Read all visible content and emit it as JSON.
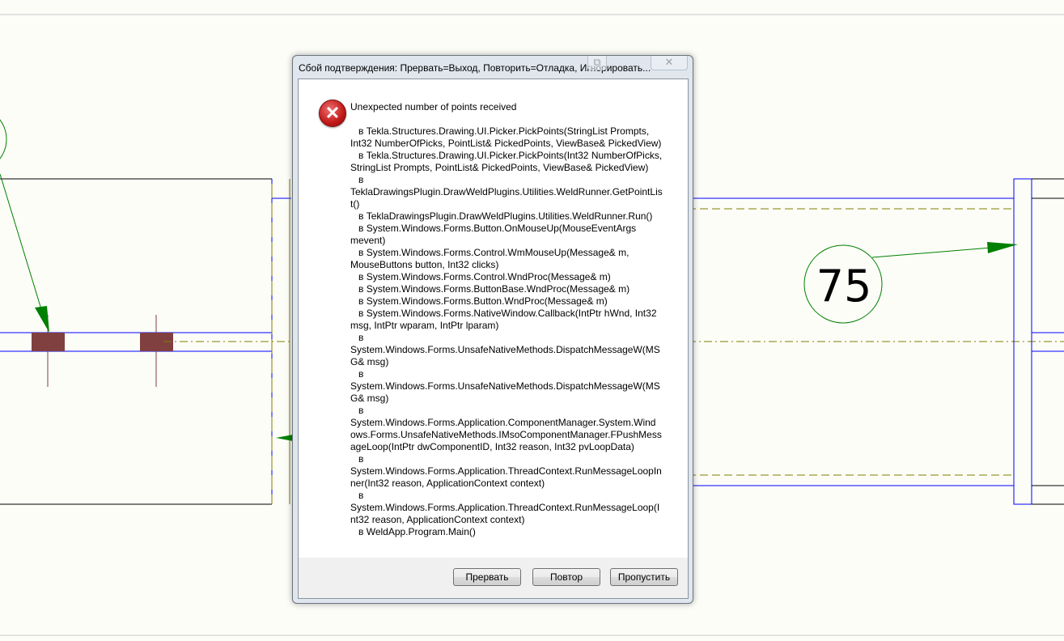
{
  "drawing": {
    "weld_mark_label": "75",
    "colors": {
      "part_outline": "#0000ff",
      "center_line": "#808000",
      "mark": "#008000",
      "weld": "#804040",
      "outline": "#000000"
    }
  },
  "dialog": {
    "title": "Сбой подтверждения: Прервать=Выход, Повторить=Отладка, Игнорировать...",
    "icon": "error-icon",
    "message": "Unexpected number of points received",
    "stack_lines": [
      "   в Tekla.Structures.Drawing.UI.Picker.PickPoints(StringList Prompts,",
      "Int32 NumberOfPicks, PointList& PickedPoints, ViewBase& PickedView)",
      "   в Tekla.Structures.Drawing.UI.Picker.PickPoints(Int32 NumberOfPicks,",
      "StringList Prompts, PointList& PickedPoints, ViewBase& PickedView)",
      "   в",
      "TeklaDrawingsPlugin.DrawWeldPlugins.Utilities.WeldRunner.GetPointLis",
      "t()",
      "   в TeklaDrawingsPlugin.DrawWeldPlugins.Utilities.WeldRunner.Run()",
      "   в System.Windows.Forms.Button.OnMouseUp(MouseEventArgs",
      "mevent)",
      "   в System.Windows.Forms.Control.WmMouseUp(Message& m,",
      "MouseButtons button, Int32 clicks)",
      "   в System.Windows.Forms.Control.WndProc(Message& m)",
      "   в System.Windows.Forms.ButtonBase.WndProc(Message& m)",
      "   в System.Windows.Forms.Button.WndProc(Message& m)",
      "   в System.Windows.Forms.NativeWindow.Callback(IntPtr hWnd, Int32",
      "msg, IntPtr wparam, IntPtr lparam)",
      "   в",
      "System.Windows.Forms.UnsafeNativeMethods.DispatchMessageW(MS",
      "G& msg)",
      "   в",
      "System.Windows.Forms.UnsafeNativeMethods.DispatchMessageW(MS",
      "G& msg)",
      "   в",
      "System.Windows.Forms.Application.ComponentManager.System.Wind",
      "ows.Forms.UnsafeNativeMethods.IMsoComponentManager.FPushMess",
      "ageLoop(IntPtr dwComponentID, Int32 reason, Int32 pvLoopData)",
      "   в",
      "System.Windows.Forms.Application.ThreadContext.RunMessageLoopIn",
      "ner(Int32 reason, ApplicationContext context)",
      "   в",
      "System.Windows.Forms.Application.ThreadContext.RunMessageLoop(I",
      "nt32 reason, ApplicationContext context)",
      "   в WeldApp.Program.Main()"
    ],
    "buttons": {
      "abort": "Прервать",
      "retry": "Повтор",
      "ignore": "Пропустить"
    },
    "close_glyph": "✕",
    "restore_glyph": "⧉"
  }
}
